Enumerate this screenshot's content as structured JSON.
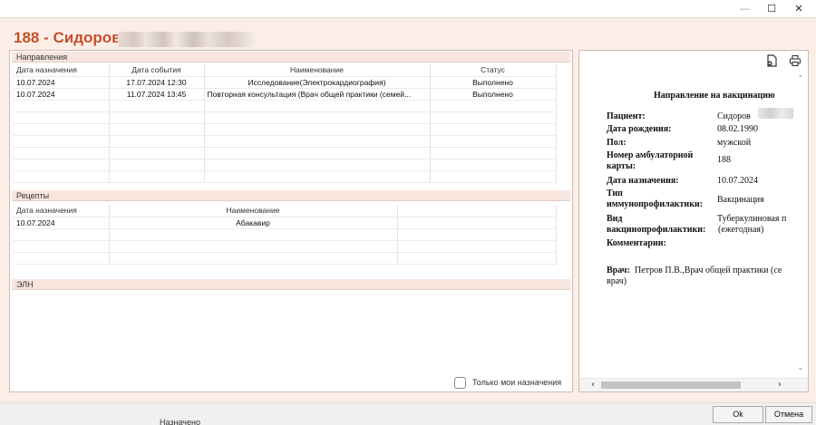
{
  "window": {
    "min_glyph": "—",
    "max_glyph": "☐",
    "close_glyph": "✕"
  },
  "header": {
    "title": "188 - Сидоров"
  },
  "directions": {
    "label": "Направления",
    "columns": [
      "Дата назначения",
      "Дата события",
      "Наименование",
      "Статус"
    ],
    "rows": [
      [
        "10.07.2024",
        "17.07.2024 12:30",
        "Исследование(Электрокардиография)",
        "Выполнено"
      ],
      [
        "10.07.2024",
        "11.07.2024 13:45",
        "Повторная консультация (Врач общей практики (семей...",
        "Выполнено"
      ]
    ]
  },
  "recipes": {
    "label": "Рецепты",
    "columns": [
      "Дата назначения",
      "Наименование"
    ],
    "rows": [
      [
        "10.07.2024",
        "Абакавир"
      ]
    ]
  },
  "eln": {
    "label": "ЭЛН"
  },
  "only_mine": {
    "label": "Только мои назначения",
    "checked": false
  },
  "document": {
    "title": "Направление на вакцинацию",
    "patient_label": "Пациент:",
    "patient_value": "Сидоров",
    "dob_label": "Дата рождения:",
    "dob_value": "08.02.1990",
    "sex_label": "Пол:",
    "sex_value": "мужской",
    "card_label_1": "Номер амбулаторной",
    "card_label_2": "карты:",
    "card_value": "188",
    "assign_label": "Дата назначения:",
    "assign_value": "10.07.2024",
    "type_label_1": "Тип",
    "type_label_2": "иммунопрофилактики:",
    "type_value": "Вакцинация",
    "kind_label_1": "Вид",
    "kind_label_2": "вакцинопрофилактики:",
    "kind_value_1": "Туберкулиновая п",
    "kind_value_2": "(ежегодная)",
    "comments_label": "Комментарии:",
    "doctor_label": "Врач:",
    "doctor_value_1": "Петров П.В.,Врач общей практики (се",
    "doctor_value_2": "врач)"
  },
  "toolbar": {
    "export_icon": "export-icon",
    "print_icon": "print-icon"
  },
  "buttons": {
    "ok": "Ok",
    "cancel": "Отмена"
  },
  "background_text": "Назначено"
}
